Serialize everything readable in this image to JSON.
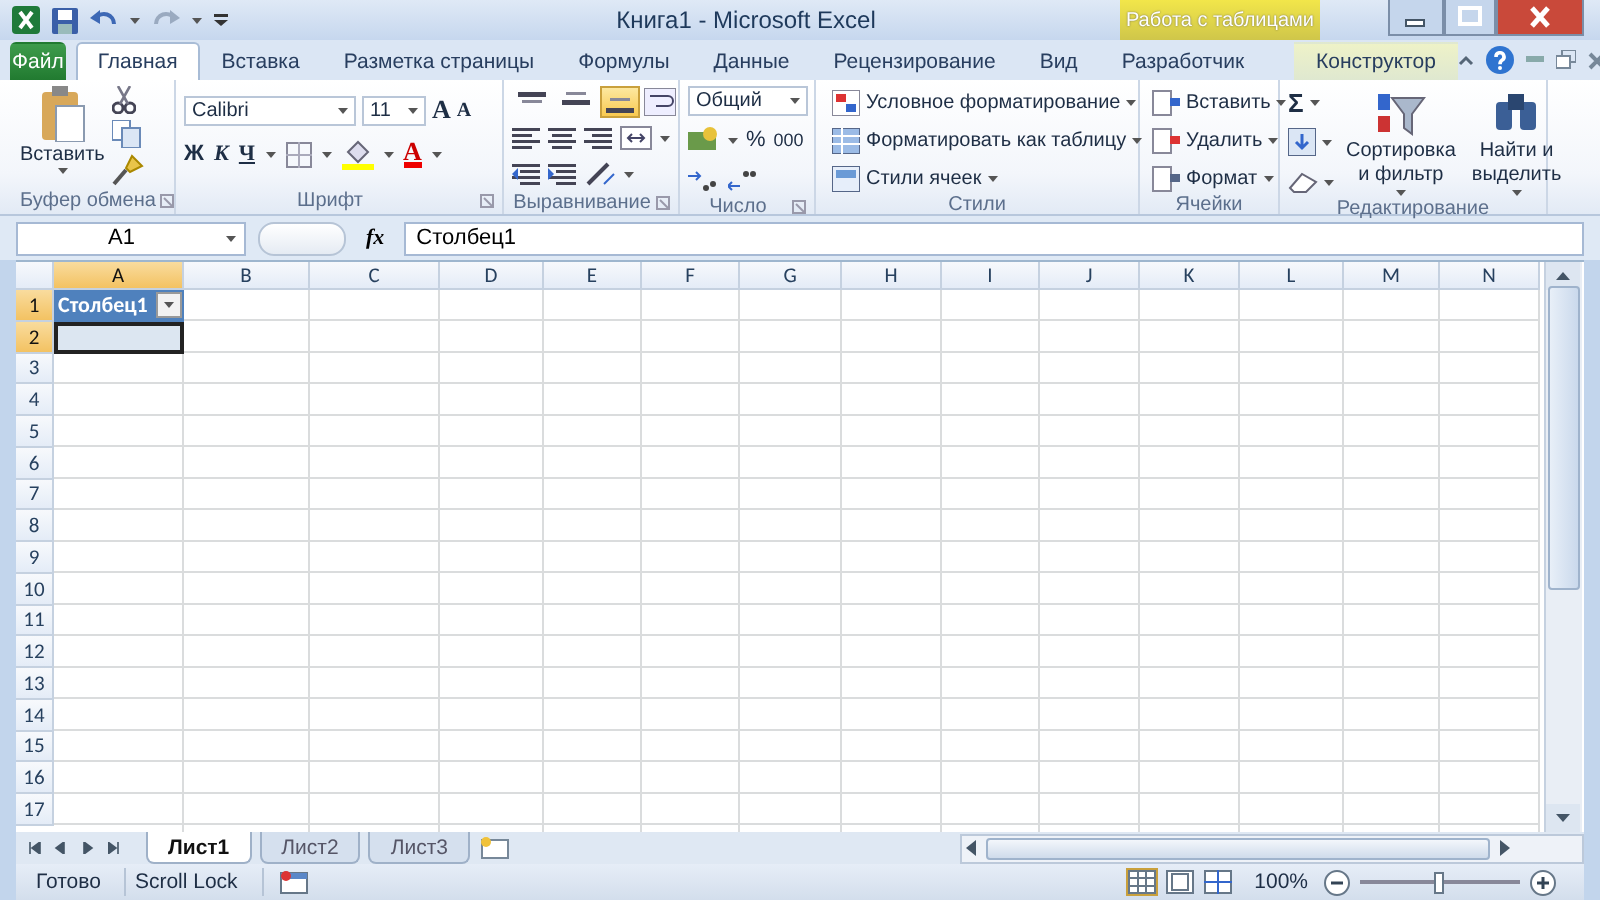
{
  "window": {
    "title": "Книга1 - Microsoft Excel",
    "context_group": "Работа с таблицами"
  },
  "tabs": [
    {
      "label": "Файл",
      "kind": "file",
      "selected": false
    },
    {
      "label": "Главная",
      "kind": "normal",
      "selected": true
    },
    {
      "label": "Вставка",
      "kind": "normal",
      "selected": false
    },
    {
      "label": "Разметка страницы",
      "kind": "normal",
      "selected": false
    },
    {
      "label": "Формулы",
      "kind": "normal",
      "selected": false
    },
    {
      "label": "Данные",
      "kind": "normal",
      "selected": false
    },
    {
      "label": "Рецензирование",
      "kind": "normal",
      "selected": false
    },
    {
      "label": "Вид",
      "kind": "normal",
      "selected": false
    },
    {
      "label": "Разработчик",
      "kind": "normal",
      "selected": false
    },
    {
      "label": "Конструктор",
      "kind": "context",
      "selected": false
    }
  ],
  "ribbon": [
    {
      "kind": "clipboard",
      "label": "Буфер обмена",
      "paste": "Вставить"
    },
    {
      "kind": "font",
      "label": "Шрифт",
      "font_name": "Calibri",
      "font_size": "11",
      "grow": "A",
      "shrink": "A",
      "bold": "Ж",
      "italic": "К",
      "underline": "Ч",
      "font_color": "A"
    },
    {
      "kind": "alignment",
      "label": "Выравнивание",
      "vertical": [
        {
          "selected": false
        },
        {
          "selected": false
        },
        {
          "selected": true
        }
      ]
    },
    {
      "kind": "number",
      "label": "Число",
      "format": "Общий",
      "percent": "%",
      "thousands": "000"
    },
    {
      "kind": "styles",
      "label": "Стили",
      "items": [
        "Условное форматирование",
        "Форматировать как таблицу",
        "Стили ячеек"
      ]
    },
    {
      "kind": "cells",
      "label": "Ячейки",
      "items": [
        "Вставить",
        "Удалить",
        "Формат"
      ]
    },
    {
      "kind": "editing",
      "label": "Редактирование",
      "sum": "Σ",
      "sort": "Сортировка и фильтр",
      "find": "Найти и выделить"
    }
  ],
  "formula_bar": {
    "name_box": "A1",
    "function_label": "fx",
    "value": "Столбец1"
  },
  "sheet": {
    "columns": [
      {
        "label": "A",
        "selected": true
      },
      {
        "label": "B",
        "selected": false
      },
      {
        "label": "C",
        "selected": false
      },
      {
        "label": "D",
        "selected": false
      },
      {
        "label": "E",
        "selected": false
      },
      {
        "label": "F",
        "selected": false
      },
      {
        "label": "G",
        "selected": false
      },
      {
        "label": "H",
        "selected": false
      },
      {
        "label": "I",
        "selected": false
      },
      {
        "label": "J",
        "selected": false
      },
      {
        "label": "K",
        "selected": false
      },
      {
        "label": "L",
        "selected": false
      },
      {
        "label": "M",
        "selected": false
      },
      {
        "label": "N",
        "selected": false
      }
    ],
    "rows": [
      {
        "label": "1",
        "selected": true
      },
      {
        "label": "2",
        "selected": true
      },
      {
        "label": "3",
        "selected": false
      },
      {
        "label": "4",
        "selected": false
      },
      {
        "label": "5",
        "selected": false
      },
      {
        "label": "6",
        "selected": false
      },
      {
        "label": "7",
        "selected": false
      },
      {
        "label": "8",
        "selected": false
      },
      {
        "label": "9",
        "selected": false
      },
      {
        "label": "10",
        "selected": false
      },
      {
        "label": "11",
        "selected": false
      },
      {
        "label": "12",
        "selected": false
      },
      {
        "label": "13",
        "selected": false
      },
      {
        "label": "14",
        "selected": false
      },
      {
        "label": "15",
        "selected": false
      },
      {
        "label": "16",
        "selected": false
      },
      {
        "label": "17",
        "selected": false
      }
    ],
    "table_header": "Столбец1"
  },
  "sheet_tabs": [
    {
      "label": "Лист1",
      "selected": true
    },
    {
      "label": "Лист2",
      "selected": false
    },
    {
      "label": "Лист3",
      "selected": false
    }
  ],
  "status_bar": {
    "status": "Готово",
    "scroll_lock": "Scroll Lock",
    "views": [
      {
        "selected": true
      },
      {
        "selected": false
      },
      {
        "selected": false
      }
    ],
    "zoom": "100%",
    "zoom_slider": {
      "level": 0.5
    }
  }
}
